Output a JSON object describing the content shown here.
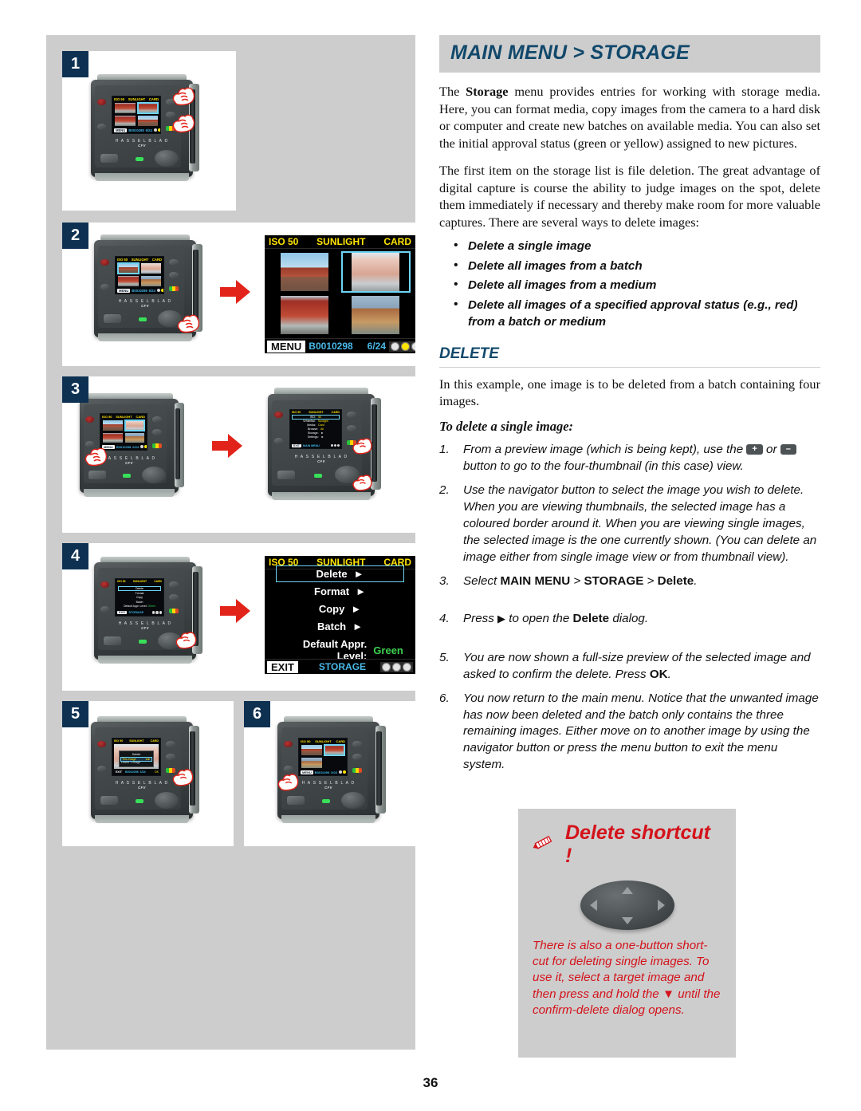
{
  "page": {
    "number": "36"
  },
  "header": {
    "title": "MAIN MENU > STORAGE"
  },
  "intro": {
    "p1_a": "The ",
    "p1_b": "Storage",
    "p1_c": " menu provides entries for working with storage media. Here, you can format media, copy images from the camera to a hard disk or computer and create new batches on available media. You can also set the initial approval status (green or yellow) assigned to new pictures.",
    "p2": "The first item on the storage list is file deletion. The great advantage of digital capture is course the ability to judge images on the spot, delete them immediately if necessary and thereby make room for more valuable captures. There are several ways to delete images:"
  },
  "bullets": [
    "Delete a single image",
    "Delete all images from a batch",
    "Delete all images from a medium",
    "Delete all images of a specified approval status (e.g., red) from a batch or medium"
  ],
  "section": {
    "title": "DELETE",
    "intro": "In this example, one image is to be deleted from a batch containing four images.",
    "lead": "To delete a single image:"
  },
  "steps": [
    {
      "num": "1.",
      "text_a": "From a preview image (which is being kept), use the ",
      "key1": "+",
      "text_b": " or ",
      "key2": "–",
      "text_c": " button to go to the four-thumbnail (in this case) view."
    },
    {
      "num": "2.",
      "text_a": "Use the navigator button to select the image you wish to delete. When you are viewing thumbnails, the selected image has a coloured border around it. When you are viewing single images, the selected image is the one currently shown. (You can delete an image either from single image view or from thumbnail view)."
    },
    {
      "num": "3.",
      "text_a": "Select ",
      "bold1": "MAIN MENU",
      "text_b": " > ",
      "bold2": "STORAGE",
      "text_c": " > ",
      "bold3": "Delete",
      "text_d": "."
    },
    {
      "num": "4.",
      "text_a": "Press ",
      "arrow": "▶",
      "text_b": " to open the ",
      "bold1": "Delete",
      "text_c": " dialog."
    },
    {
      "num": "5.",
      "text_a": "You are now shown a full-size preview of the selected image and asked to confirm the delete. Press ",
      "bold1": "OK",
      "text_b": "."
    },
    {
      "num": "6.",
      "text_a": "You now return to the main menu. Notice that the unwanted image has now been deleted and the batch only contains the three remaining images. Either move on to another image by using the navigator button or press the menu button to exit the menu system."
    }
  ],
  "tip": {
    "title": "Delete shortcut !",
    "icon": "pencil-icon",
    "navpad_icon": "navigator-pad-icon",
    "body_a": "There is also a one-button short-cut for deleting single images. To use it, select a target image and then press and hold the ",
    "tri": "▼",
    "body_b": " until the confirm-delete dialog opens.",
    "color": "#d4121a"
  },
  "panels": [
    {
      "id": "1",
      "badge": "1"
    },
    {
      "id": "2",
      "badge": "2"
    },
    {
      "id": "3",
      "badge": "3"
    },
    {
      "id": "4",
      "badge": "4"
    },
    {
      "id": "5",
      "badge": "5"
    },
    {
      "id": "6",
      "badge": "6"
    }
  ],
  "camera": {
    "brand": "H A S S E L B L A D",
    "model": "CFV"
  },
  "screens": {
    "thumbnail_big": {
      "iso": "ISO 50",
      "wb": "SUNLIGHT",
      "media": "CARD",
      "menu_label": "MENU",
      "batch": "B0010298",
      "counter": "6/24",
      "thumbs": [
        "ph-a",
        "ph-b",
        "ph-c",
        "ph-d"
      ],
      "selected_index": 1,
      "approval_dots": [
        "off",
        "on",
        "off"
      ]
    },
    "storage_menu_big": {
      "iso": "ISO 50",
      "wb": "SUNLIGHT",
      "media": "CARD",
      "rows": [
        {
          "label": "Delete",
          "caret": "►",
          "selected": true
        },
        {
          "label": "Format",
          "caret": "►",
          "selected": false
        },
        {
          "label": "Copy",
          "caret": "►",
          "selected": false
        },
        {
          "label": "Batch",
          "caret": "►",
          "selected": false
        },
        {
          "label": "Default Appr. Level:",
          "value": "Green",
          "selected": false
        }
      ],
      "exit_label": "EXIT",
      "title_label": "STORAGE"
    },
    "main_menu_small": {
      "iso": "ISO 50",
      "wb": "SUNLIGHT",
      "media": "CARD",
      "rows": [
        {
          "label": "ISO:",
          "value": "50"
        },
        {
          "label": "WhiteBal:",
          "value": "Sunlight"
        },
        {
          "label": "Media:",
          "value": "Card"
        },
        {
          "label": "Browse:",
          "value": "All"
        },
        {
          "label": "Storage:",
          "value": "►"
        },
        {
          "label": "Settings:",
          "value": "►"
        }
      ],
      "exit_label": "EXIT",
      "title_label": "MAIN MENU"
    },
    "delete_dialog_small": {
      "iso": "ISO 50",
      "wb": "SUNLIGHT",
      "media": "CARD",
      "title": "Delete",
      "row_selected": "This image",
      "row_hint": "Delete 1 image",
      "ok_label": "OK",
      "exit_label": "EXIT",
      "batch": "B0010298",
      "counter": "6/24"
    },
    "thumbnail_small_3": {
      "iso": "ISO 50",
      "wb": "SUNLIGHT",
      "media": "CARD",
      "menu_label": "MENU",
      "batch": "B0010299",
      "counter": "5/23"
    }
  },
  "colors": {
    "page_bg": "#ffffff",
    "panel_bg": "#cdcdcd",
    "badge_bg": "#0e3152",
    "heading": "#11486b",
    "tip_red": "#d4121a",
    "lcd_yellow": "#ffe400",
    "lcd_blue": "#49b9e8",
    "lcd_select": "#6fd4f5",
    "lcd_green": "#3dd14f",
    "arrow_red": "#e2231a"
  }
}
